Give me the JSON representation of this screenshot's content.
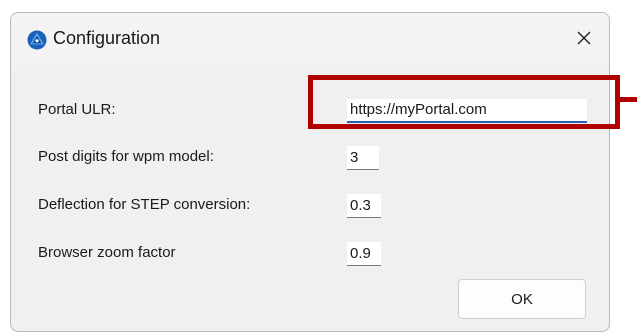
{
  "dialog": {
    "title": "Configuration",
    "app_icon": "app-logo-icon",
    "close_icon": "close-icon",
    "close_glyph": "✕"
  },
  "fields": [
    {
      "label": "Portal ULR:",
      "value": "https://myPortal.com"
    },
    {
      "label": "Post digits for wpm model:",
      "value": "3"
    },
    {
      "label": "Deflection for STEP conversion:",
      "value": "0.3"
    },
    {
      "label": "Browser zoom factor",
      "value": "0.9"
    }
  ],
  "buttons": {
    "ok_label": "OK"
  },
  "colors": {
    "highlight": "#b00000",
    "focus_underline": "#2f5fb3",
    "dialog_background": "#f0f0f0"
  }
}
